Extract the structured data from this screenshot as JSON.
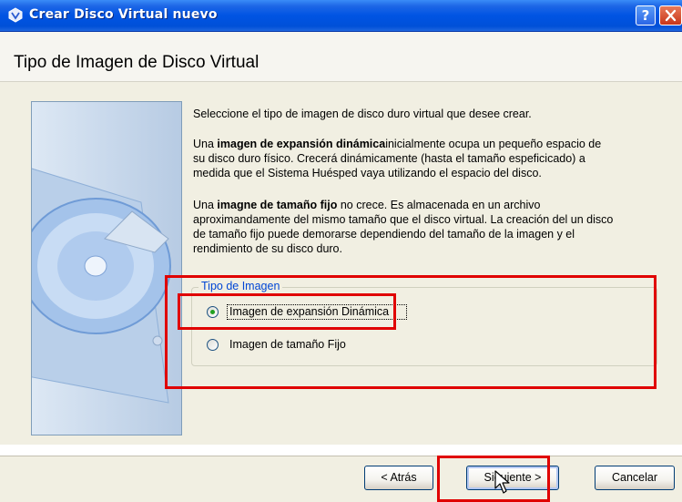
{
  "window": {
    "title": "Crear Disco Virtual nuevo",
    "help_label": "?",
    "close_label": "✕"
  },
  "header": {
    "title": "Tipo de Imagen de Disco Virtual"
  },
  "body": {
    "intro": "Seleccione el tipo de imagen de disco duro virtual que desee crear.",
    "dynamic_desc": {
      "prefix": "Una ",
      "bold": "imagen de expansión dinámica",
      "rest_line1": "inicialmente ocupa un pequeño espacio de",
      "line2": "su disco duro físico. Crecerá dinámicamente (hasta el tamaño espeficicado) a",
      "line3": "medida que el Sistema Huésped vaya utilizando el espacio del disco."
    },
    "fixed_desc": {
      "prefix": "Una ",
      "bold": "imagne de tamaño fijo",
      "rest_line1": " no crece. Es almacenada en un archivo",
      "line2": "aproximandamente del mismo tamaño que el disco virtual. La creación del un disco",
      "line3": "de tamaño fijo puede demorarse dependiendo del tamaño de la imagen y el",
      "line4": "rendimiento de su disco duro."
    }
  },
  "image_type_group": {
    "label": "Tipo de Imagen",
    "options": [
      {
        "label": "Imagen de expansión Dinámica",
        "selected": true
      },
      {
        "label": "Imagen de tamaño Fijo",
        "selected": false
      }
    ]
  },
  "buttons": {
    "back": "< Atrás",
    "next": "Siguiente >",
    "cancel": "Cancelar"
  },
  "colors": {
    "title_bar": "#0054e3",
    "group_label": "#0046d5",
    "annotation": "#e00000",
    "radio_dot": "#21a121"
  }
}
